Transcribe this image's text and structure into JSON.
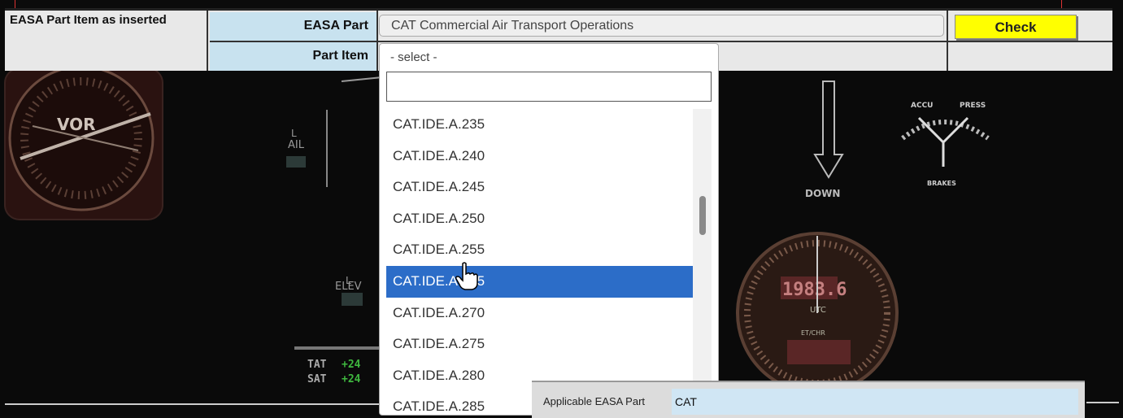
{
  "form": {
    "title": "EASA Part Item as inserted",
    "easa_part_label": "EASA Part",
    "easa_part_value": "CAT Commercial Air Transport Operations",
    "part_item_label": "Part Item",
    "check_label": "Check"
  },
  "dropdown": {
    "selected_text": "- select -",
    "search_value": "",
    "items": [
      "CAT.IDE.A.235",
      "CAT.IDE.A.240",
      "CAT.IDE.A.245",
      "CAT.IDE.A.250",
      "CAT.IDE.A.255",
      "CAT.IDE.A.265",
      "CAT.IDE.A.270",
      "CAT.IDE.A.275",
      "CAT.IDE.A.280",
      "CAT.IDE.A.285"
    ],
    "highlighted_index": 5
  },
  "info_panel": {
    "label": "Applicable EASA Part",
    "value": "CAT"
  },
  "background_text": {
    "vor": "VOR",
    "ail": "AIL",
    "elev": "ELEV",
    "l1": "L",
    "l2": "L",
    "down": "DOWN",
    "accu": "ACCU",
    "press": "PRESS",
    "brakes": "BRAKES",
    "tat": "TAT",
    "sat": "SAT",
    "tat_val": "+24",
    "sat_val": "+24",
    "clock_reading": "1983.6",
    "clock_utc": "UTC",
    "clock_et": "ET/CHR"
  },
  "colors": {
    "accent": "#2c6dc8",
    "check_button": "#ffff00",
    "label_bg": "#c8e2ef"
  }
}
